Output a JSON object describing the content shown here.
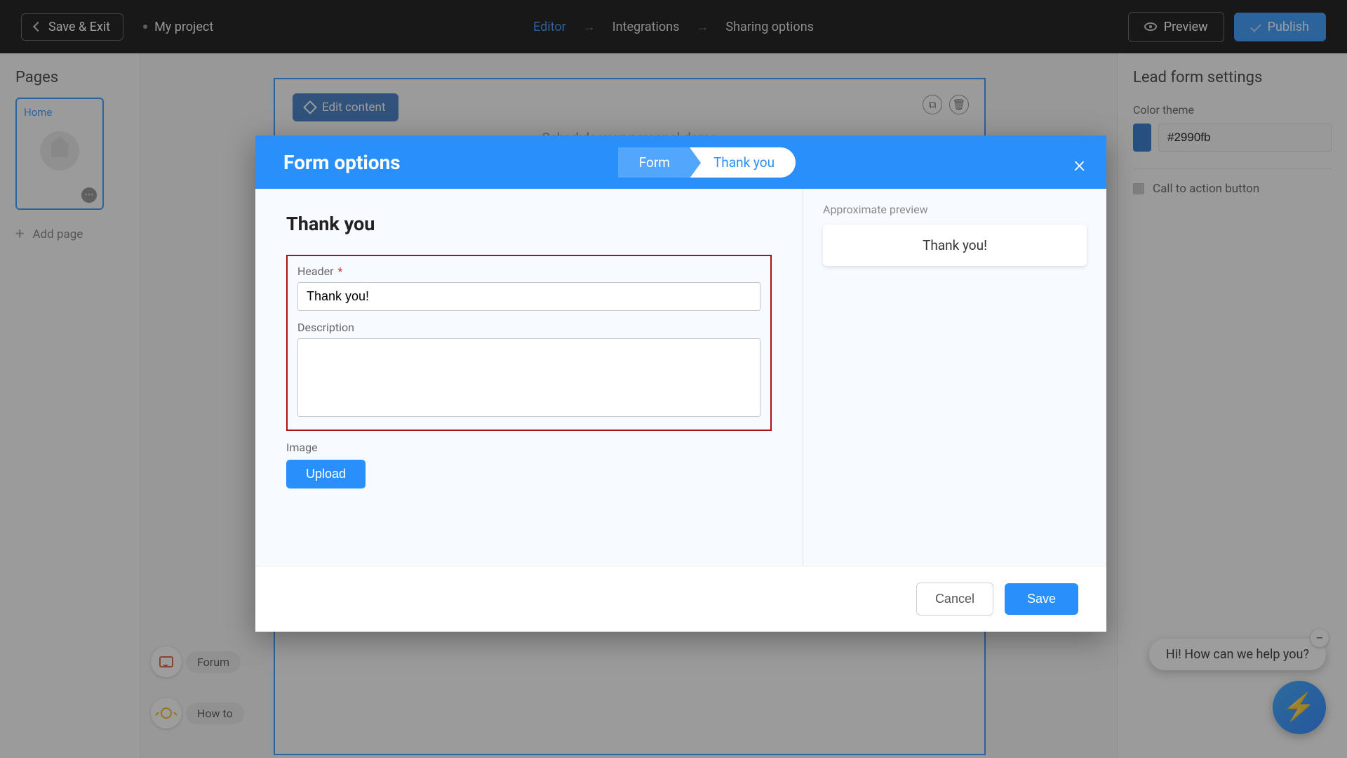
{
  "topbar": {
    "save_exit": "Save & Exit",
    "project": "My project",
    "nav": {
      "editor": "Editor",
      "integrations": "Integrations",
      "sharing": "Sharing options"
    },
    "preview": "Preview",
    "publish": "Publish"
  },
  "left": {
    "title": "Pages",
    "page_label": "Home",
    "add_page": "Add page"
  },
  "canvas": {
    "edit_content": "Edit content",
    "title": "Schedule your personal demo"
  },
  "right": {
    "title": "Lead form settings",
    "color_theme_label": "Color theme",
    "hex": "#2990fb",
    "cta_label": "Call to action button"
  },
  "help": {
    "forum": "Forum",
    "howto": "How to"
  },
  "chat": {
    "msg": "Hi! How can we help you?"
  },
  "modal": {
    "title": "Form options",
    "tab_form": "Form",
    "tab_thank": "Thank you",
    "section_title": "Thank you",
    "header_label": "Header",
    "header_value": "Thank you!",
    "description_label": "Description",
    "description_value": "",
    "image_label": "Image",
    "upload": "Upload",
    "preview_label": "Approximate preview",
    "preview_text": "Thank you!",
    "cancel": "Cancel",
    "save": "Save"
  }
}
